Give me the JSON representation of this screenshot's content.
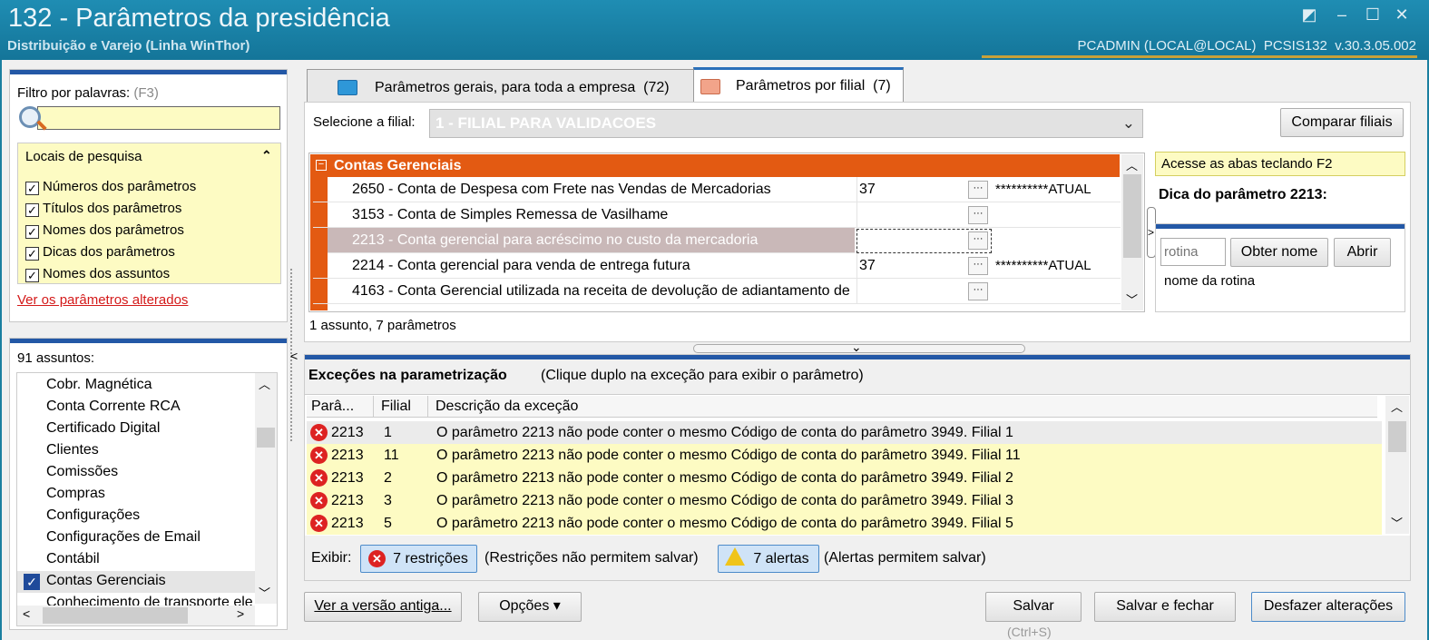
{
  "window": {
    "title": "132 - Parâmetros da presidência",
    "subtitle": "Distribuição e Varejo (Linha WinThor)",
    "sys_info": "PCADMIN (LOCAL@LOCAL)  PCSIS132  v.30.3.05.002",
    "controls": [
      "◩",
      "–",
      "☐",
      "✕"
    ]
  },
  "filter": {
    "label": "Filtro por palavras:",
    "shortcut": "(F3)",
    "value": "",
    "locais_title": "Locais de pesquisa",
    "options": [
      "Números dos parâmetros",
      "Títulos dos parâmetros",
      "Nomes dos parâmetros",
      "Dicas dos parâmetros",
      "Nomes dos assuntos"
    ],
    "altered_link": "Ver os parâmetros alterados"
  },
  "subjects": {
    "count_label": "91 assuntos:",
    "items": [
      "Cobr. Magnética",
      "Conta Corrente RCA",
      "Certificado Digital",
      "Clientes",
      "Comissões",
      "Compras",
      "Configurações",
      "Configurações de Email",
      "Contábil",
      "Contas Gerenciais",
      "Conhecimento de transporte ele"
    ],
    "checked": "Contas Gerenciais"
  },
  "tabs": [
    {
      "label": "Parâmetros gerais, para toda a empresa",
      "count": "(72)"
    },
    {
      "label": "Parâmetros por filial",
      "count": "(7)"
    }
  ],
  "filial": {
    "label": "Selecione a filial:",
    "value": "1 - FILIAL PARA VALIDACOES",
    "compare_button": "Comparar filiais"
  },
  "grid": {
    "group": "Contas Gerenciais",
    "rows": [
      {
        "label": "2650 - Conta de Despesa com Frete nas Vendas de Mercadorias",
        "value": "37",
        "mask": "**********ATUAL"
      },
      {
        "label": "3153 - Conta de Simples Remessa de Vasilhame",
        "value": "",
        "mask": ""
      },
      {
        "label": "2213 - Conta gerencial para acréscimo no custo da mercadoria",
        "value": "",
        "mask": ""
      },
      {
        "label": "2214 - Conta gerencial para venda de entrega futura",
        "value": "37",
        "mask": "**********ATUAL"
      },
      {
        "label": "4163 - Conta Gerencial utilizada na receita de devolução de adiantamento de",
        "value": "",
        "mask": ""
      }
    ],
    "status": "1 assunto, 7 parâmetros",
    "dots": "···"
  },
  "hint": {
    "banner": "Acesse as abas teclando F2",
    "title": "Dica do parâmetro 2213:",
    "rotina_placeholder": "rotina",
    "obter_button": "Obter nome",
    "abrir_button": "Abrir",
    "rotina_name": "nome da rotina"
  },
  "exceptions": {
    "title": "Exceções na parametrização",
    "subtitle": "(Clique duplo na exceção para exibir o parâmetro)",
    "col_param": "Parâ...",
    "col_filial": "Filial",
    "col_desc": "Descrição da exceção",
    "rows": [
      {
        "param": "2213",
        "filial": "1",
        "desc": "O parâmetro 2213 não pode conter o mesmo Código de conta do parâmetro 3949. Filial 1"
      },
      {
        "param": "2213",
        "filial": "11",
        "desc": "O parâmetro 2213 não pode conter o mesmo Código de conta do parâmetro 3949. Filial 11"
      },
      {
        "param": "2213",
        "filial": "2",
        "desc": "O parâmetro 2213 não pode conter o mesmo Código de conta do parâmetro 3949. Filial 2"
      },
      {
        "param": "2213",
        "filial": "3",
        "desc": "O parâmetro 2213 não pode conter o mesmo Código de conta do parâmetro 3949. Filial 3"
      },
      {
        "param": "2213",
        "filial": "5",
        "desc": "O parâmetro 2213 não pode conter o mesmo Código de conta do parâmetro 3949. Filial 5"
      }
    ],
    "exibir": "Exibir:",
    "restricoes_btn": "7 restrições",
    "restricoes_note": "(Restrições não permitem salvar)",
    "alertas_btn": "7 alertas",
    "alertas_note": "(Alertas permitem salvar)"
  },
  "footer": {
    "old_version": "Ver a versão antiga...",
    "options": "Opções ▾",
    "save": "Salvar",
    "save_hint": "(Ctrl+S)",
    "save_close": "Salvar e fechar",
    "undo": "Desfazer alterações"
  },
  "colors": {
    "titlebar": "#1a82a8",
    "group_orange": "#e35a12",
    "selected_row": "#c9b8b8",
    "exception_yellow": "#fdfbc3",
    "accent_blue": "#2358a6"
  }
}
